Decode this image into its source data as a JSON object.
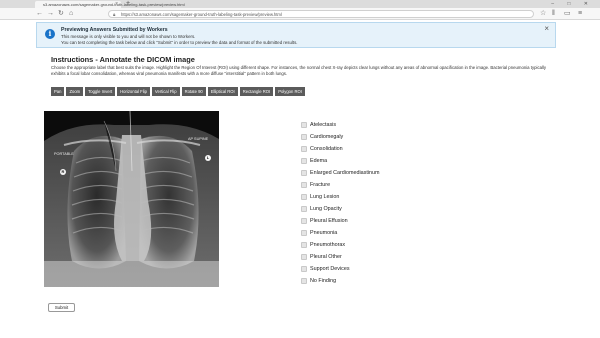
{
  "browser": {
    "tab_title": "s3.amazonaws.com/sagemaker-ground-truth-labeling-task-preview/preview.html",
    "tab_close_icon": "close-icon",
    "new_tab_glyph": "+",
    "url": "https://s3.amazonaws.com/sagemaker-ground-truth-labeling-task-preview/preview.html",
    "window_controls": "– □ ✕"
  },
  "banner": {
    "title": "Previewing Answers Submitted by Workers",
    "line1": "This message is only visible to you and will not be shown to Workers.",
    "line2": "You can test completing the task below and click \"Submit\" in order to preview the data and format of the submitted results.",
    "close_glyph": "×",
    "color": "#e6f2fa"
  },
  "instructions": {
    "title": "Instructions - Annotate the DICOM image",
    "text": "Choose the appropriate label that best suits the image. Highlight the Region Of Interest (ROI) using different shape. For instances, the normal chest X-ray depicts clear lungs without any areas of abnormal opacification in the image. Bacterial pneumonia typically exhibits a focal lobar consolidation, whereas viral pneumonia manifests with a more diffuse \"interstitial\" pattern in both lungs."
  },
  "toolbar": [
    "Pan",
    "Zoom",
    "Toggle Invert",
    "Horizontal Flip",
    "Vertical Flip",
    "Rotate 90",
    "Elliptical ROI",
    "Rectangle ROI",
    "Polygon ROI"
  ],
  "image": {
    "label_left": "PORTABLE",
    "label_right": "AP SUPINE"
  },
  "labels": [
    "Atelectasis",
    "Cardiomegaly",
    "Consolidation",
    "Edema",
    "Enlarged Cardiomediastinum",
    "Fracture",
    "Lung Lesion",
    "Lung Opacity",
    "Pleural Effusion",
    "Pneumonia",
    "Pneumothorax",
    "Pleural Other",
    "Support Devices",
    "No Finding"
  ],
  "submit_label": "Submit"
}
